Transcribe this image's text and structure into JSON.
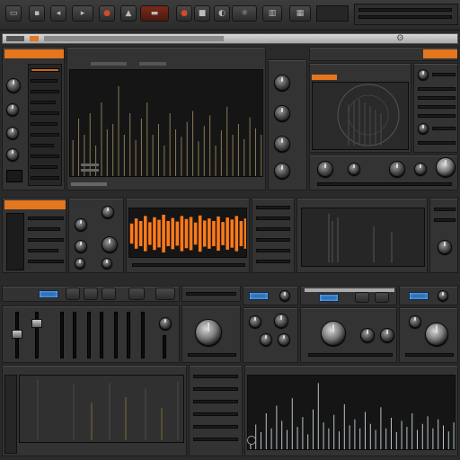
{
  "toolbar": {
    "buttons": [
      "file-icon",
      "save-icon",
      "undo-icon",
      "redo-icon",
      "metronome-icon",
      "loop-icon",
      "record-icon",
      "play-icon",
      "stop-icon",
      "settings-icon",
      "view-icon",
      "mixer-icon"
    ]
  },
  "colors": {
    "accent": "#e4761e",
    "panel": "#333333",
    "screen": "#151515",
    "lcd_blue": "#2d6fb8",
    "waveform": "#d4a85a",
    "spectrum_orange": "#ff7a1a"
  },
  "spectrum": {
    "bars": [
      0.35,
      0.55,
      0.4,
      0.6,
      0.3,
      0.7,
      0.45,
      0.5,
      0.85,
      0.4,
      0.6,
      0.35,
      0.55,
      0.7,
      0.4,
      0.5,
      0.3,
      0.6,
      0.45,
      0.38,
      0.52,
      0.62,
      0.34,
      0.48,
      0.58,
      0.3,
      0.44,
      0.66,
      0.4,
      0.5,
      0.36,
      0.56,
      0.46,
      0.4
    ]
  },
  "waveform": {
    "bars": [
      0.2,
      0.35,
      0.25,
      0.5,
      0.3,
      0.6,
      0.4,
      0.28,
      0.7,
      0.32,
      0.45,
      0.22,
      0.55,
      0.9,
      0.38,
      0.3,
      0.48,
      0.26,
      0.62,
      0.34,
      0.42,
      0.3,
      0.52,
      0.36,
      0.28,
      0.58,
      0.3,
      0.44,
      0.25,
      0.4,
      0.32,
      0.5,
      0.28,
      0.36,
      0.46,
      0.3,
      0.42,
      0.34,
      0.26,
      0.38
    ]
  },
  "orange_wave": {
    "bars": [
      0.4,
      0.6,
      0.5,
      0.7,
      0.45,
      0.65,
      0.55,
      0.75,
      0.5,
      0.62,
      0.48,
      0.7,
      0.58,
      0.66,
      0.44,
      0.72,
      0.52,
      0.6,
      0.5,
      0.68,
      0.46,
      0.64,
      0.56,
      0.7,
      0.5,
      0.6
    ]
  }
}
